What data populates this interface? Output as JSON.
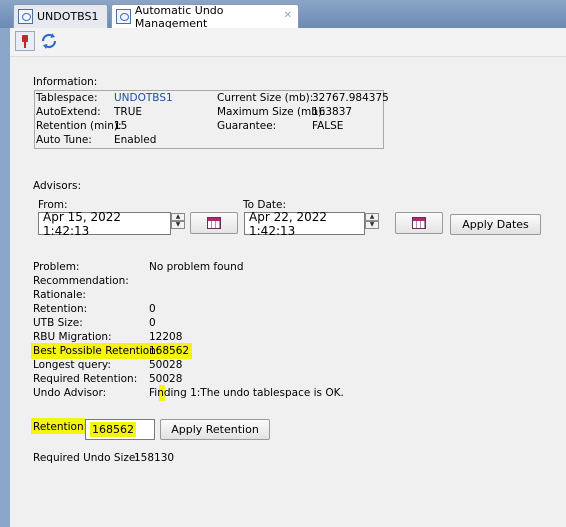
{
  "tabs": [
    {
      "label": "UNDOTBS1"
    },
    {
      "label": "Automatic Undo Management"
    }
  ],
  "information": {
    "heading": "Information:",
    "tablespace_label": "Tablespace:",
    "tablespace_value": "UNDOTBS1",
    "autoextend_label": "AutoExtend:",
    "autoextend_value": "TRUE",
    "retention_label": "Retention (min):",
    "retention_value": "15",
    "autotune_label": "Auto Tune:",
    "autotune_value": "Enabled",
    "current_size_label": "Current Size (mb):",
    "current_size_value": "32767.984375",
    "max_size_label": "Maximum Size (mb):",
    "max_size_value": "163837",
    "guarantee_label": "Guarantee:",
    "guarantee_value": "FALSE"
  },
  "advisors": {
    "heading": "Advisors:",
    "from_label": "From:",
    "from_value": "Apr 15, 2022 1:42:13",
    "to_label": "To Date:",
    "to_value": "Apr 22, 2022 1:42:13",
    "apply_dates_label": "Apply Dates"
  },
  "results": {
    "problem_label": "Problem:",
    "problem_value": "No problem found",
    "recommendation_label": "Recommendation:",
    "rationale_label": "Rationale:",
    "retention_label": "Retention:",
    "retention_value": "0",
    "utb_label": "UTB Size:",
    "utb_value": "0",
    "rbu_label": "RBU Migration:",
    "rbu_value": "12208",
    "best_label": "Best Possible Retention:",
    "best_value": "168562",
    "longest_label": "Longest query:",
    "longest_value": "50028",
    "required_label": "Required Retention:",
    "required_value": "50028",
    "advisor_label": "Undo Advisor:",
    "advisor_value": "Finding 1:The undo tablespace is OK."
  },
  "retention_form": {
    "label": "Retention:",
    "value": "168562",
    "apply_label": "Apply Retention"
  },
  "required_undo": {
    "label": "Required Undo Size:",
    "value": "158130"
  }
}
